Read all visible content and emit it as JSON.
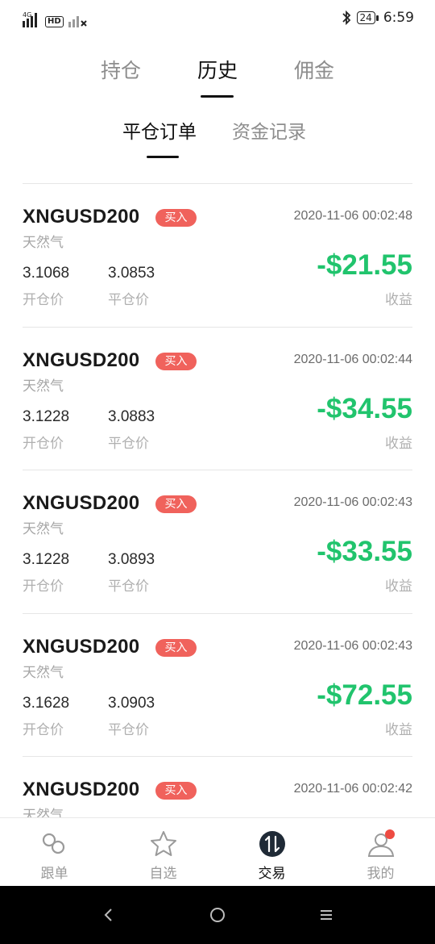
{
  "status_bar": {
    "network": "4G",
    "hd": "HD",
    "battery": "24",
    "time": "6:59"
  },
  "top_tabs": [
    {
      "label": "持仓",
      "active": false
    },
    {
      "label": "历史",
      "active": true
    },
    {
      "label": "佣金",
      "active": false
    }
  ],
  "sub_tabs": [
    {
      "label": "平仓订单",
      "active": true
    },
    {
      "label": "资金记录",
      "active": false
    }
  ],
  "orders": [
    {
      "symbol": "XNGUSD200",
      "side": "买入",
      "time": "2020-11-06 00:02:48",
      "name": "天然气",
      "open_price": "3.1068",
      "close_price": "3.0853",
      "open_label": "开仓价",
      "close_label": "平仓价",
      "profit": "-$21.55",
      "profit_label": "收益"
    },
    {
      "symbol": "XNGUSD200",
      "side": "买入",
      "time": "2020-11-06 00:02:44",
      "name": "天然气",
      "open_price": "3.1228",
      "close_price": "3.0883",
      "open_label": "开仓价",
      "close_label": "平仓价",
      "profit": "-$34.55",
      "profit_label": "收益"
    },
    {
      "symbol": "XNGUSD200",
      "side": "买入",
      "time": "2020-11-06 00:02:43",
      "name": "天然气",
      "open_price": "3.1228",
      "close_price": "3.0893",
      "open_label": "开仓价",
      "close_label": "平仓价",
      "profit": "-$33.55",
      "profit_label": "收益"
    },
    {
      "symbol": "XNGUSD200",
      "side": "买入",
      "time": "2020-11-06 00:02:43",
      "name": "天然气",
      "open_price": "3.1628",
      "close_price": "3.0903",
      "open_label": "开仓价",
      "close_label": "平仓价",
      "profit": "-$72.55",
      "profit_label": "收益"
    },
    {
      "symbol": "XNGUSD200",
      "side": "买入",
      "time": "2020-11-06 00:02:42",
      "name": "天然气",
      "open_price": "",
      "close_price": "",
      "open_label": "",
      "close_label": "",
      "profit": "",
      "profit_label": ""
    }
  ],
  "bottom_nav": [
    {
      "label": "跟单",
      "icon": "link-icon",
      "active": false
    },
    {
      "label": "自选",
      "icon": "star-icon",
      "active": false
    },
    {
      "label": "交易",
      "icon": "trade-icon",
      "active": true
    },
    {
      "label": "我的",
      "icon": "user-icon",
      "active": false,
      "badge": true
    }
  ],
  "colors": {
    "profit_negative": "#21c46d",
    "buy_badge": "#f0625c",
    "active_text": "#111111",
    "inactive_text": "#8d8d8d"
  }
}
